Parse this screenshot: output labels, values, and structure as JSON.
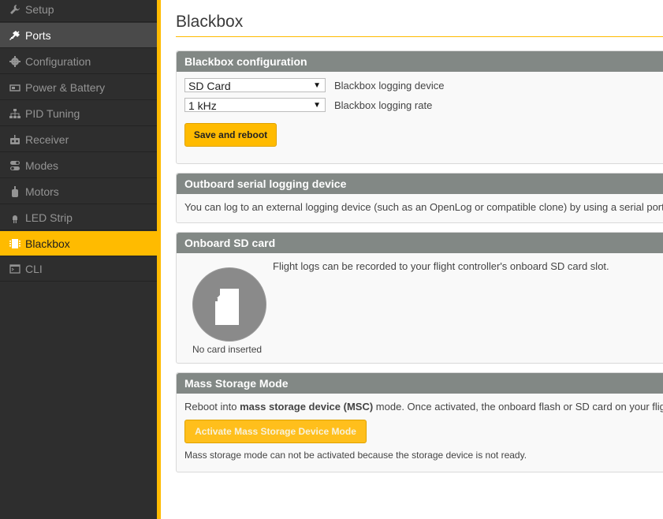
{
  "sidebar": {
    "items": [
      {
        "label": "Setup",
        "icon": "wrench-icon"
      },
      {
        "label": "Ports",
        "icon": "plug-icon"
      },
      {
        "label": "Configuration",
        "icon": "gear-icon"
      },
      {
        "label": "Power & Battery",
        "icon": "battery-icon"
      },
      {
        "label": "PID Tuning",
        "icon": "pid-tree-icon"
      },
      {
        "label": "Receiver",
        "icon": "receiver-icon"
      },
      {
        "label": "Modes",
        "icon": "toggles-icon"
      },
      {
        "label": "Motors",
        "icon": "motor-icon"
      },
      {
        "label": "LED Strip",
        "icon": "led-icon"
      },
      {
        "label": "Blackbox",
        "icon": "blackbox-icon"
      },
      {
        "label": "CLI",
        "icon": "terminal-icon"
      }
    ],
    "highlighted": "Ports",
    "active": "Blackbox"
  },
  "page": {
    "title": "Blackbox"
  },
  "config": {
    "header": "Blackbox configuration",
    "device_value": "SD Card",
    "device_label": "Blackbox logging device",
    "rate_value": "1 kHz",
    "rate_label": "Blackbox logging rate",
    "save_button": "Save and reboot"
  },
  "outboard": {
    "header": "Outboard serial logging device",
    "text": "You can log to an external logging device (such as an OpenLog or compatible clone) by using a serial port. Con"
  },
  "sdcard": {
    "header": "Onboard SD card",
    "text": "Flight logs can be recorded to your flight controller's onboard SD card slot.",
    "status": "No card inserted"
  },
  "msc": {
    "header": "Mass Storage Mode",
    "text_pre": "Reboot into ",
    "text_bold": "mass storage device (MSC)",
    "text_post": " mode. Once activated, the onboard flash or SD card on your flight co",
    "button": "Activate Mass Storage Device Mode",
    "note": "Mass storage mode can not be activated because the storage device is not ready."
  },
  "colors": {
    "accent": "#ffbb00",
    "sidebar": "#2e2e2e",
    "header": "#828885"
  }
}
